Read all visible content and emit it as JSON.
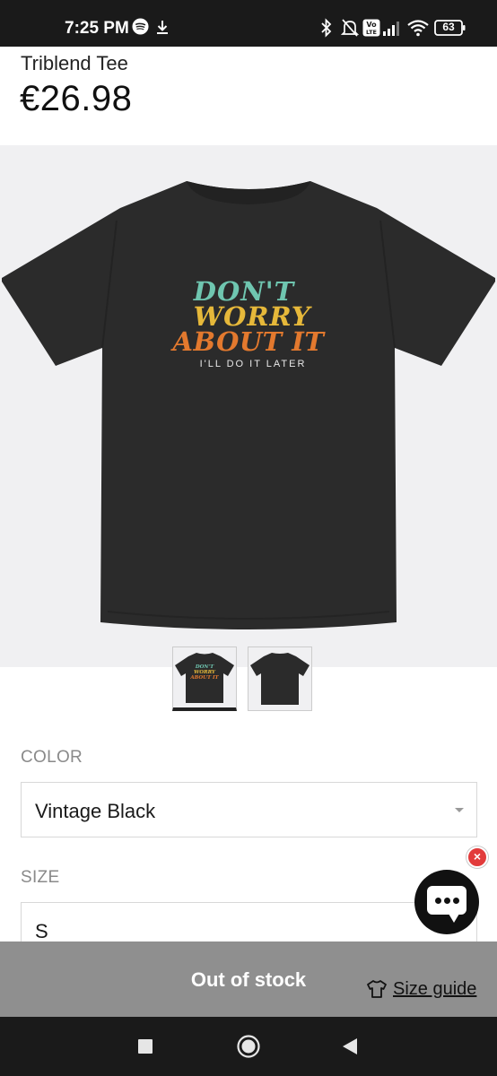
{
  "status_bar": {
    "time": "7:25 PM",
    "battery": "63"
  },
  "product": {
    "title": "Triblend Tee",
    "price": "€26.98"
  },
  "print": {
    "line1": "DON'T",
    "line2": "WORRY",
    "line3": "ABOUT IT",
    "tagline": "I'LL DO IT LATER"
  },
  "thumbnail_print": {
    "line1": "DON'T",
    "line2": "WORRY",
    "line3": "ABOUT IT"
  },
  "options": {
    "color_label": "COLOR",
    "color_value": "Vintage Black",
    "size_label": "SIZE",
    "size_value": "S"
  },
  "actions": {
    "out_of_stock": "Out of stock",
    "size_guide": "Size guide"
  },
  "chat": {
    "close_glyph": "×"
  },
  "colors": {
    "shirt": "#2b2b2b",
    "print_teal": "#6fc6b0",
    "print_yellow": "#e6b83a",
    "print_orange": "#e3792e",
    "bottom_bar": "#8f8f8f"
  }
}
